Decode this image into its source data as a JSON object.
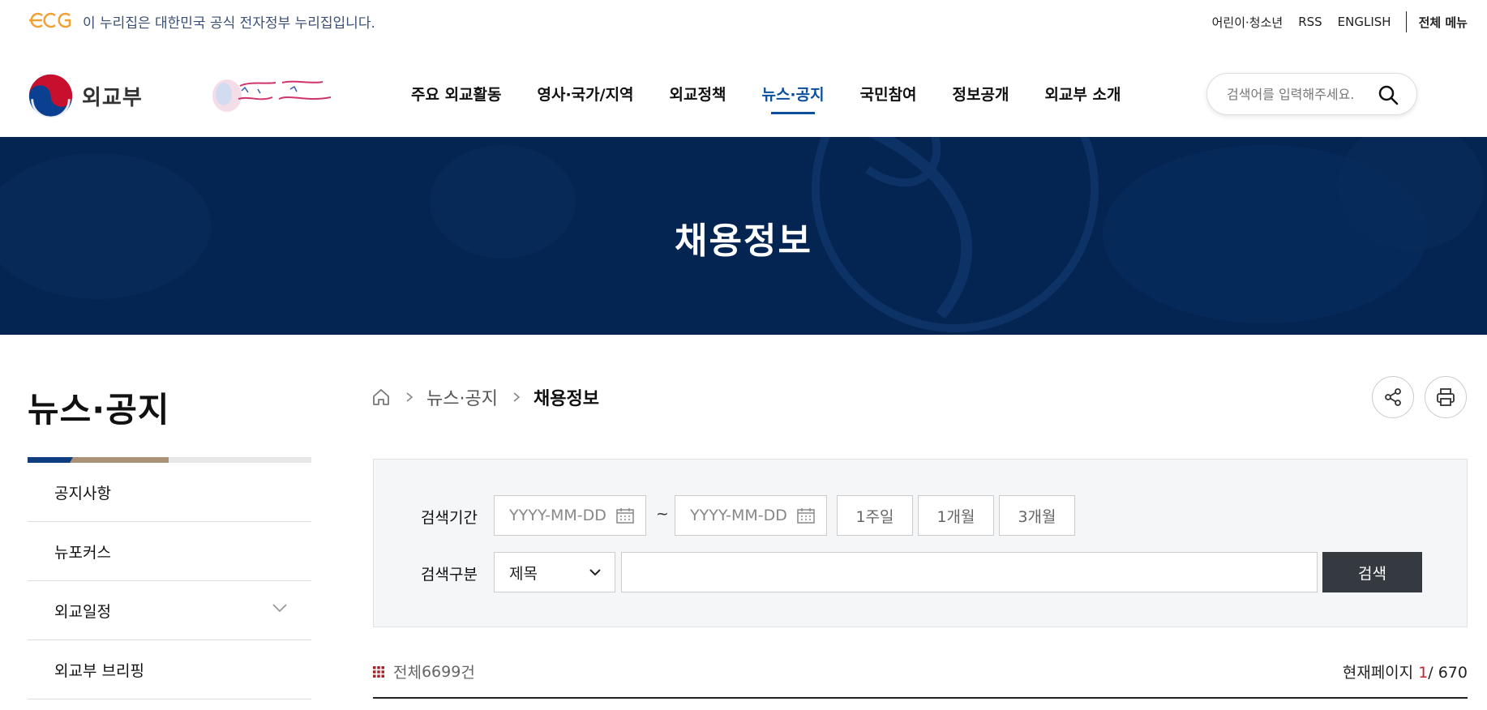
{
  "gov_bar": {
    "notice": "이 누리집은 대한민국 공식 전자정부 누리집입니다.",
    "links": [
      "어린이·청소년",
      "RSS",
      "ENGLISH"
    ],
    "all_menu": "전체 메뉴"
  },
  "header": {
    "logo_text": "외교부",
    "gnb": [
      "주요 외교활동",
      "영사·국가/지역",
      "외교정책",
      "뉴스·공지",
      "국민참여",
      "정보공개",
      "외교부 소개"
    ],
    "active_gnb_index": 3,
    "search_placeholder": "검색어를 입력해주세요."
  },
  "banner": {
    "title": "채용정보"
  },
  "lnb": {
    "title": "뉴스·공지",
    "items": [
      "공지사항",
      "뉴포커스",
      "외교일정",
      "외교부 브리핑"
    ]
  },
  "breadcrumb": {
    "middle": "뉴스·공지",
    "current": "채용정보"
  },
  "search_panel": {
    "period_label": "검색기간",
    "date_placeholder": "YYYY-MM-DD",
    "tilde": "~",
    "periods": [
      "1주일",
      "1개월",
      "3개월"
    ],
    "type_label": "검색구분",
    "type_selected": "제목",
    "search_button": "검색"
  },
  "list_info": {
    "total_prefix": "전체 ",
    "total_count": "6699",
    "total_suffix": " 건",
    "page_label": "현재페이지 ",
    "current_page": "1",
    "total_pages": "/ 670"
  },
  "colors": {
    "banner_bg": "#042552",
    "active_nav": "#0b4f9c",
    "search_button_bg": "#343a40",
    "current_page": "#c0262d"
  }
}
